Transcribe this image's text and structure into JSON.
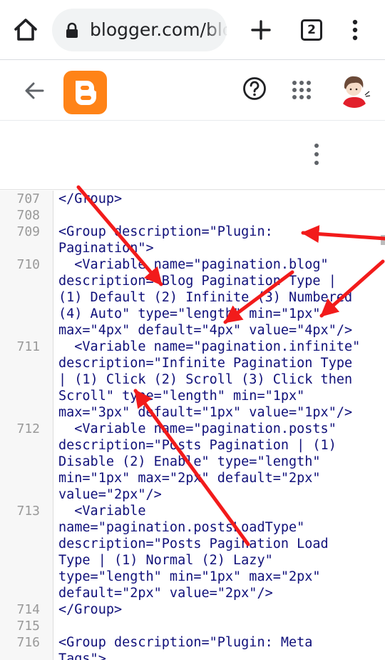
{
  "browser": {
    "url": "blogger.com/blog",
    "tab_count": "2",
    "icons": {
      "home": "home-icon",
      "lock": "lock-icon",
      "new_tab": "plus-icon",
      "menu": "more-vert-icon"
    }
  },
  "header": {
    "icons": {
      "back": "arrow-back-icon",
      "logo": "blogger-logo",
      "help": "help-circle-icon",
      "apps": "apps-grid-icon",
      "avatar": "user-avatar"
    }
  },
  "colors": {
    "blogger_orange": "#ff8317",
    "code_text": "#10107a",
    "line_number": "#999999",
    "annotation_arrow": "#f21b1b"
  },
  "editor": {
    "lines": [
      {
        "number": "707",
        "text": "</Group>"
      },
      {
        "number": "708",
        "text": ""
      },
      {
        "number": "709",
        "text": "<Group description=\"Plugin:\nPagination\">"
      },
      {
        "number": "710",
        "text": "  <Variable name=\"pagination.blog\"\ndescription=\"Blog Pagination Type |\n(1) Default (2) Infinite (3) Numbered\n(4) Auto\" type=\"length\" min=\"1px\"\nmax=\"4px\" default=\"4px\" value=\"4px\"/>"
      },
      {
        "number": "711",
        "text": "  <Variable name=\"pagination.infinite\"\ndescription=\"Infinite Pagination Type\n| (1) Click (2) Scroll (3) Click then\nScroll\" type=\"length\" min=\"1px\"\nmax=\"3px\" default=\"1px\" value=\"1px\"/>"
      },
      {
        "number": "712",
        "text": "  <Variable name=\"pagination.posts\"\ndescription=\"Posts Pagination | (1)\nDisable (2) Enable\" type=\"length\"\nmin=\"1px\" max=\"2px\" default=\"2px\"\nvalue=\"2px\"/>"
      },
      {
        "number": "713",
        "text": "  <Variable\nname=\"pagination.postsLoadType\"\ndescription=\"Posts Pagination Load\nType | (1) Normal (2) Lazy\"\ntype=\"length\" min=\"1px\" max=\"2px\"\ndefault=\"2px\" value=\"2px\"/>"
      },
      {
        "number": "714",
        "text": "</Group>"
      },
      {
        "number": "715",
        "text": ""
      },
      {
        "number": "716",
        "text": "<Group description=\"Plugin: Meta\nTags\">"
      }
    ]
  }
}
